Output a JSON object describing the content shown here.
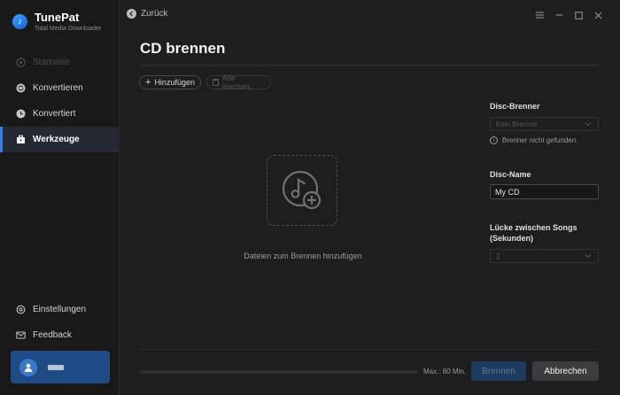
{
  "app": {
    "name": "TunePat",
    "subtitle": "Tidal Media Downloader"
  },
  "colors": {
    "accent": "#2f7ef0",
    "background": "#1e1e20",
    "sidebar": "#19191a",
    "user_card": "#1f4b86"
  },
  "sidebar": {
    "items": [
      {
        "label": "Startseite",
        "icon": "home-icon",
        "state": "disabled"
      },
      {
        "label": "Konvertieren",
        "icon": "convert-icon",
        "state": "normal"
      },
      {
        "label": "Konvertiert",
        "icon": "clock-icon",
        "state": "normal"
      },
      {
        "label": "Werkzeuge",
        "icon": "toolbox-icon",
        "state": "active"
      }
    ],
    "bottom_items": [
      {
        "label": "Einstellungen",
        "icon": "gear-icon"
      },
      {
        "label": "Feedback",
        "icon": "mail-icon"
      }
    ]
  },
  "topbar": {
    "back_label": "Zurück"
  },
  "page": {
    "title": "CD brennen",
    "add_label": "Hinzufügen",
    "clear_label": "Alle löschen",
    "drop_text": "Dateien zum Brennen hinzufügen"
  },
  "panel": {
    "burner_label": "Disc-Brenner",
    "burner_value": "Kein Brenner",
    "burner_hint": "Brenner nicht gefunden.",
    "name_label": "Disc-Name",
    "name_value": "My CD",
    "gap_label_line1": "Lücke zwischen Songs",
    "gap_label_line2": "(Sekunden)",
    "gap_value": "2"
  },
  "footer": {
    "progress": 0,
    "max_label": "Max.: 80 Min.",
    "burn_label": "Brennen",
    "cancel_label": "Abbrechen"
  }
}
